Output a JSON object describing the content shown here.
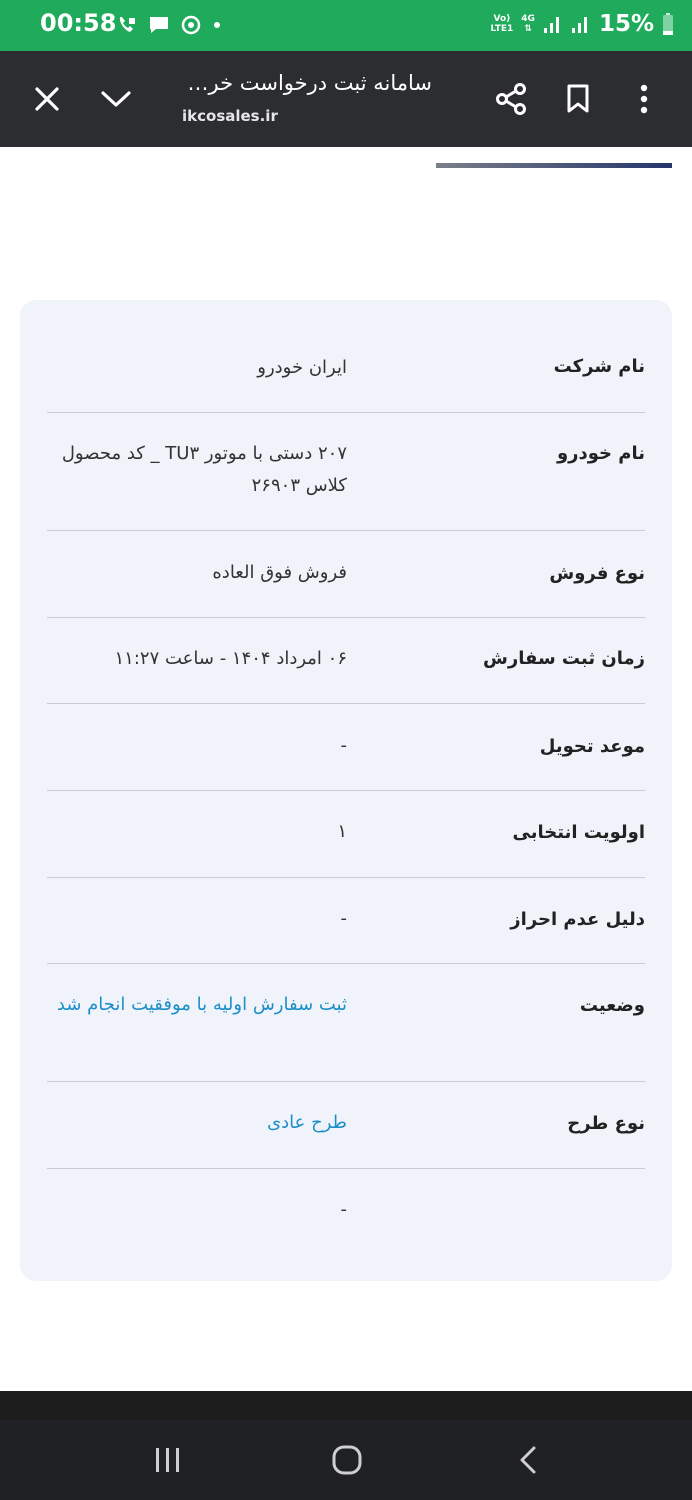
{
  "status_bar": {
    "time": "00:58",
    "network_top": "Vo)",
    "network_bottom": "LTE1",
    "network_gen": "4G",
    "battery": "15%"
  },
  "toolbar": {
    "title": "سامانه ثبت درخواست خرید خودرو",
    "url": "ikcosales.ir"
  },
  "details": [
    {
      "label": "نام شرکت",
      "value": "ایران خودرو",
      "style": "normal"
    },
    {
      "label": "نام خودرو",
      "value": "۲۰۷ دستی با موتور TU۳ _ کد محصول کلاس ۲۶۹۰۳",
      "style": "normal"
    },
    {
      "label": "نوع فروش",
      "value": "فروش فوق العاده",
      "style": "normal"
    },
    {
      "label": "زمان ثبت سفارش",
      "value": "۰۶ امرداد ۱۴۰۴ - ساعت ۱۱:۲۷",
      "style": "normal"
    },
    {
      "label": "موعد تحویل",
      "value": "-",
      "style": "normal"
    },
    {
      "label": "اولویت انتخابی",
      "value": "۱",
      "style": "normal"
    },
    {
      "label": "دلیل عدم احراز",
      "value": "-",
      "style": "normal"
    },
    {
      "label": "وضعیت",
      "value": "ثبت سفارش اولیه با موفقیت انجام شد",
      "style": "link"
    },
    {
      "label": "نوع طرح",
      "value": "طرح عادی",
      "style": "link"
    },
    {
      "label": "",
      "value": "-",
      "style": "normal"
    }
  ],
  "colors": {
    "status_bar": "#1fab5b",
    "toolbar": "#2b2d30",
    "card": "#f0f3fa",
    "link": "#1d8fc8"
  }
}
